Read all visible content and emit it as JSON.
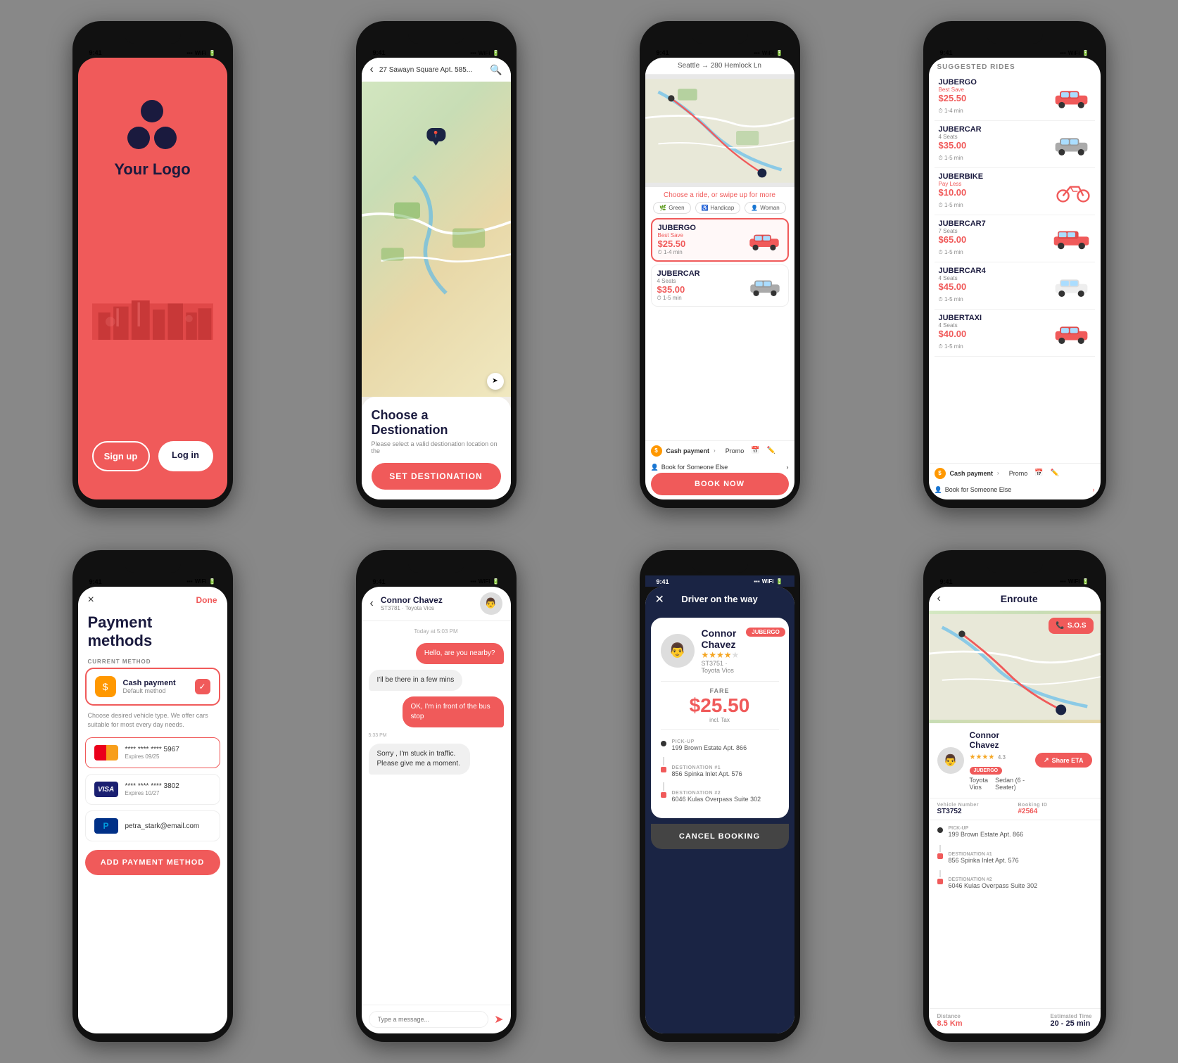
{
  "phone1": {
    "time": "9:41",
    "brand": "Your Logo",
    "signup": "Sign up",
    "login": "Log in"
  },
  "phone2": {
    "time": "9:41",
    "address": "27 Sawayn Square Apt. 585...",
    "title": "Choose a Destionation",
    "subtitle": "Please select a valid destionation location on the",
    "btn": "SET DESTIONATION"
  },
  "phone3": {
    "time": "9:41",
    "route": "Seattle → 280 Hemlock Ln",
    "prompt": "Choose a ride, or swipe up for more",
    "filters": [
      "Green",
      "Handicap",
      "Woman"
    ],
    "rides": [
      {
        "name": "JUBERGO",
        "tag": "Best Save",
        "price": "$25.50",
        "time": "1-4 min",
        "selected": true
      },
      {
        "name": "JUBERCAR",
        "tag": "4 Seats",
        "price": "$35.00",
        "time": "1-5 min",
        "selected": false
      }
    ],
    "payment": "Cash payment",
    "promo": "Promo",
    "bookBtn": "BOOK NOW",
    "bookSomeone": "Book for Someone Else"
  },
  "phone4": {
    "time": "9:41",
    "sectionTitle": "SUGGESTED RIDES",
    "rides": [
      {
        "name": "JUBERGO",
        "sub": "Best Save",
        "price": "$25.50",
        "time": "1-4 min",
        "type": "sedan"
      },
      {
        "name": "JUBERCAR",
        "sub": "4 Seats",
        "price": "$35.00",
        "time": "1-5 min",
        "type": "sedan"
      },
      {
        "name": "JUBERBIKE",
        "sub": "Pay Less",
        "price": "$10.00",
        "time": "1-5 min",
        "type": "bike"
      },
      {
        "name": "JUBERCAR7",
        "sub": "7 Seats",
        "price": "$65.00",
        "time": "1-5 min",
        "type": "suv"
      },
      {
        "name": "JUBERCAR4",
        "sub": "4 Seats",
        "price": "$45.00",
        "time": "1-5 min",
        "type": "sedan"
      },
      {
        "name": "JUBERTAXI",
        "sub": "4 Seats",
        "price": "$40.00",
        "time": "1-5 min",
        "type": "taxi"
      }
    ],
    "payment": "Cash payment",
    "promo": "Promo",
    "bookSomeone": "Book for Someone Else"
  },
  "phone5": {
    "time": "9:41",
    "title": "Payment methods",
    "sectionLabel": "CURRENT METHOD",
    "cashMethod": "Cash payment",
    "cashSub": "Default method",
    "desc": "Choose desired vehicle type. We offer cars suitable for most every day needs.",
    "cards": [
      {
        "type": "mastercard",
        "number": "**** **** **** 5967",
        "expiry": "Expires 09/25"
      },
      {
        "type": "visa",
        "number": "**** **** **** 3802",
        "expiry": "Expires 10/27"
      },
      {
        "type": "paypal",
        "number": "petra_stark@email.com",
        "expiry": ""
      }
    ],
    "addBtn": "ADD PAYMENT METHOD",
    "done": "Done",
    "close": "×"
  },
  "phone6": {
    "time": "9:41",
    "driverName": "Connor Chavez",
    "driverSub": "ST3781 · Toyota Vios",
    "timestamp": "Today at 5:03 PM",
    "messages": [
      {
        "text": "Hello, are you nearby?",
        "type": "sent"
      },
      {
        "text": "I'll be there in a few mins",
        "type": "received"
      },
      {
        "text": "OK, I'm in front of the bus stop",
        "type": "sent"
      },
      {
        "text": "Sorry , I'm stuck in traffic. Please give me a moment.",
        "type": "received",
        "time": "5:33 PM"
      }
    ],
    "inputPlaceholder": "Type a message..."
  },
  "phone7": {
    "time": "9:41",
    "title": "Driver on the way",
    "driverName": "Connor Chavez",
    "driverTag": "JUBERGO",
    "driverPlate": "ST3751 · Toyota Vios",
    "stars": "★★★★",
    "fare": "$25.50",
    "fareLabel": "FARE",
    "taxNote": "incl. Tax",
    "pickup": "199 Brown Estate Apt. 866",
    "dest1Label": "DESTIONATION #1",
    "dest1": "856 Spinka Inlet Apt. 576",
    "dest2Label": "DESTIONATION #2",
    "dest2": "6046 Kulas Overpass Suite 302",
    "cancelBtn": "CANCEL BOOKING"
  },
  "phone8": {
    "time": "9:41",
    "title": "Enroute",
    "sosBtn": "S.O.S",
    "driverName": "Connor Chavez",
    "driverTag": "JUBERGO",
    "driverCar": "Toyota Vios",
    "driverCarType": "Sedan (6 - Seater)",
    "stars": "★★★★",
    "rating": "4.3",
    "shareEta": "Share ETA",
    "vehicleLabel": "Vehicle Number",
    "vehicleNum": "ST3752",
    "bookingLabel": "Booking ID",
    "bookingId": "#2564",
    "pickupLabel": "PICK-UP",
    "pickup": "199 Brown Estate Apt. 866",
    "dest1Label": "DESTIONATION #1",
    "dest1": "856 Spinka Inlet Apt. 576",
    "dest2Label": "DESTIONATION #2",
    "dest2": "6046 Kulas Overpass Suite 302",
    "distLabel": "Distance",
    "dist": "8.5 Km",
    "etaLabel": "Estimated Time",
    "eta": "20 - 25 min"
  }
}
